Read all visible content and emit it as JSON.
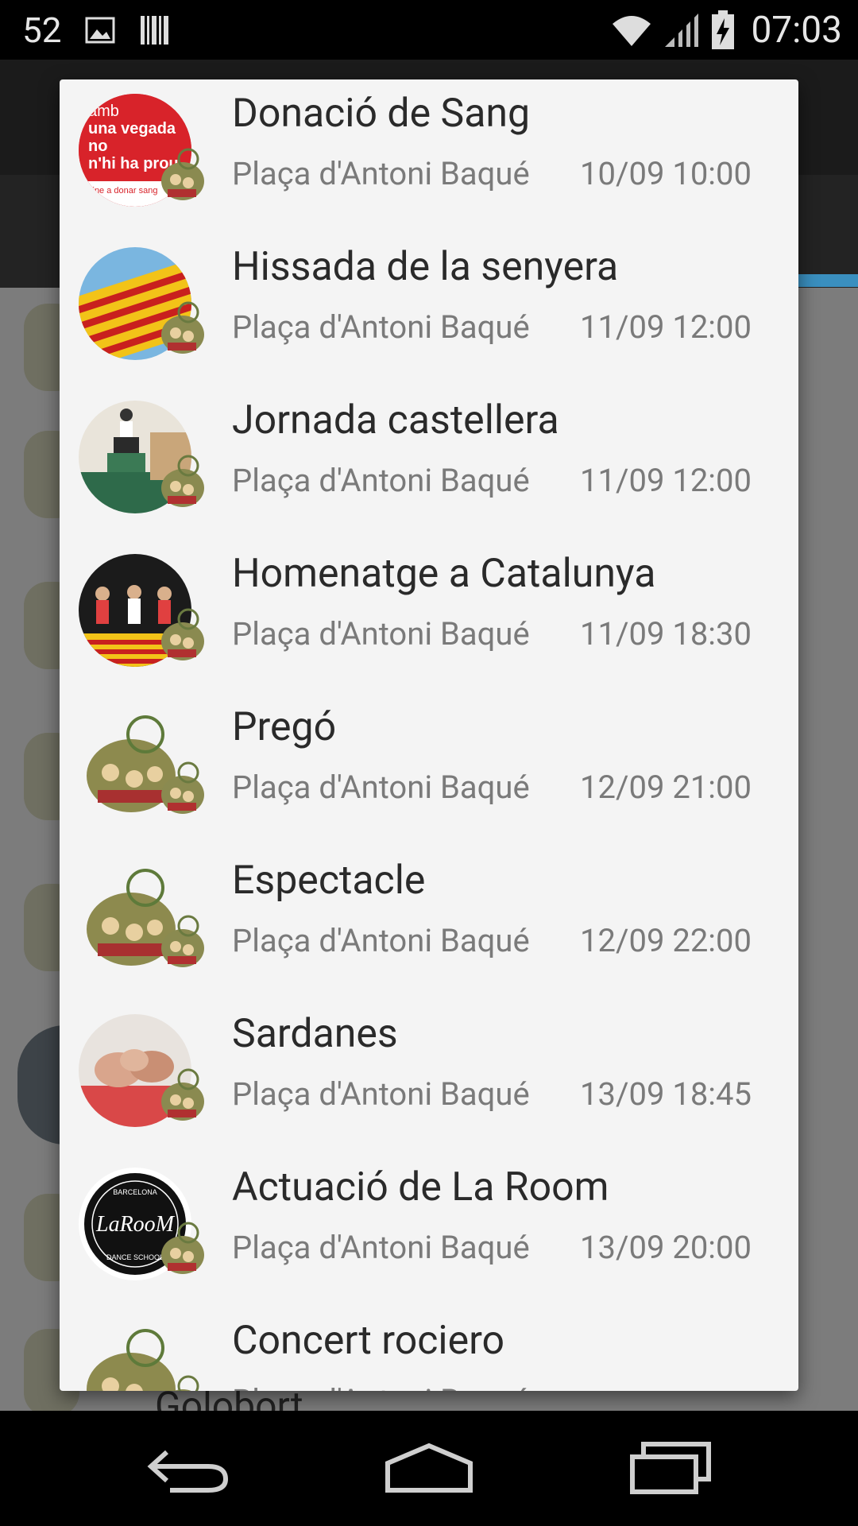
{
  "status_bar": {
    "left_number": "52",
    "time": "07:03",
    "icons": [
      "image-icon",
      "barcode-icon",
      "wifi-icon",
      "signal-icon",
      "battery-charging-icon"
    ]
  },
  "background": {
    "partial_text": "Golobort"
  },
  "events": [
    {
      "title": "Donació de Sang",
      "place": "Plaça d'Antoni Baqué",
      "datetime": "10/09 10:00",
      "thumb": "blood-donation-poster",
      "thumb_text": [
        "amb",
        "una vegada",
        "no",
        "n'hi ha prou",
        "vine a donar sang"
      ]
    },
    {
      "title": "Hissada de la senyera",
      "place": "Plaça d'Antoni Baqué",
      "datetime": "11/09 12:00",
      "thumb": "catalan-flag"
    },
    {
      "title": "Jornada castellera",
      "place": "Plaça d'Antoni Baqué",
      "datetime": "11/09 12:00",
      "thumb": "human-tower"
    },
    {
      "title": "Homenatge a Catalunya",
      "place": "Plaça d'Antoni Baqué",
      "datetime": "11/09 18:30",
      "thumb": "folk-dancers"
    },
    {
      "title": "Pregó",
      "place": "Plaça d'Antoni Baqué",
      "datetime": "12/09 21:00",
      "thumb": "festival-logo"
    },
    {
      "title": "Espectacle",
      "place": "Plaça d'Antoni Baqué",
      "datetime": "12/09 22:00",
      "thumb": "festival-logo"
    },
    {
      "title": "Sardanes",
      "place": "Plaça d'Antoni Baqué",
      "datetime": "13/09 18:45",
      "thumb": "holding-hands"
    },
    {
      "title": "Actuació de La Room",
      "place": "Plaça d'Antoni Baqué",
      "datetime": "13/09 20:00",
      "thumb": "la-room-logo",
      "thumb_text": [
        "LaRooM",
        "BARCELONA",
        "DANCE SCHOOL"
      ]
    },
    {
      "title": "Concert rociero",
      "place": "Plaça d'Antoni Baqué",
      "datetime": "",
      "thumb": "festival-logo"
    }
  ],
  "nav_bar": {
    "buttons": [
      "back-icon",
      "home-icon",
      "recents-icon"
    ]
  },
  "colors": {
    "dialog_bg": "#f4f4f4",
    "title_text": "#2a2a2a",
    "secondary_text": "#7a7a7a",
    "accent": "#3a8fbf"
  }
}
